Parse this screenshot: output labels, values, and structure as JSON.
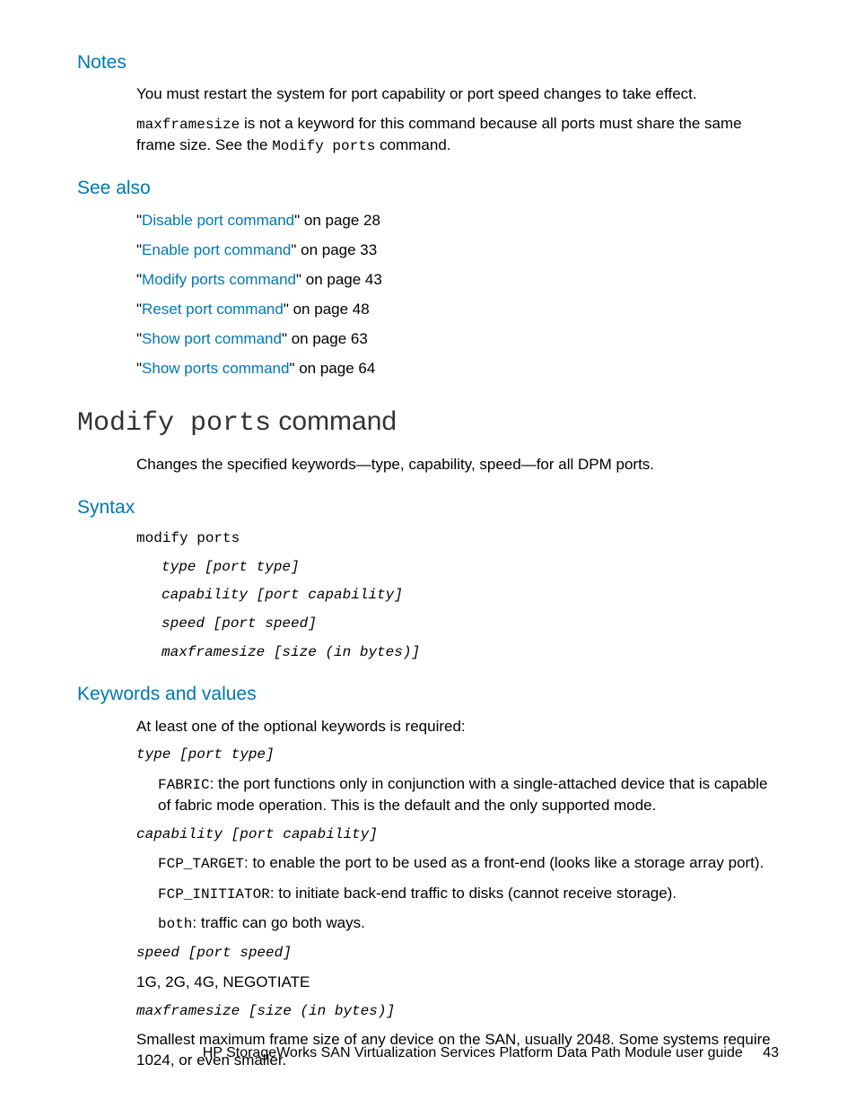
{
  "notes": {
    "heading": "Notes",
    "p1": "You must restart the system for port capability or port speed changes to take effect.",
    "p2a": "maxframesize",
    "p2b": " is not a keyword for this command because all ports must share the same frame size. See the ",
    "p2c": "Modify ports",
    "p2d": " command."
  },
  "seealso": {
    "heading": "See also",
    "items": [
      {
        "link": "Disable port command",
        "suffix": "\" on page 28"
      },
      {
        "link": "Enable port command",
        "suffix": "\" on page 33"
      },
      {
        "link": "Modify ports command",
        "suffix": "\" on page 43"
      },
      {
        "link": "Reset port command",
        "suffix": "\" on page 48"
      },
      {
        "link": "Show port command",
        "suffix": "\" on page 63"
      },
      {
        "link": "Show ports command",
        "suffix": "\" on page 64"
      }
    ]
  },
  "cmd": {
    "title_mono": "Modify ports",
    "title_rest": " command",
    "desc": "Changes the specified keywords—type, capability, speed—for all DPM ports."
  },
  "syntax": {
    "heading": "Syntax",
    "line0": "modify ports",
    "line1": "type [port type]",
    "line2": "capability [port capability]",
    "line3": "speed [port speed]",
    "line4": "maxframesize [size (in bytes)]"
  },
  "kv": {
    "heading": "Keywords and values",
    "intro": "At least one of the optional keywords is required:",
    "k1": "type [port type]",
    "k1_v_mono": "FABRIC",
    "k1_v_rest": ": the port functions only in conjunction with a single-attached device that is capable of fabric mode operation. This is the default and the only supported mode.",
    "k2": "capability [port capability]",
    "k2_a_mono": "FCP_TARGET",
    "k2_a_rest": ": to enable the port to be used as a front-end (looks like a storage array port).",
    "k2_b_mono": "FCP_INITIATOR",
    "k2_b_rest": ": to initiate back-end traffic to disks (cannot receive storage).",
    "k2_c_mono": "both",
    "k2_c_rest": ": traffic can go both ways.",
    "k3": "speed [port speed]",
    "k3_v": "1G, 2G, 4G, NEGOTIATE",
    "k4": "maxframesize [size (in bytes)]",
    "k4_v": "Smallest maximum frame size of any device on the SAN, usually 2048. Some systems require 1024, or even smaller."
  },
  "footer": {
    "title": "HP StorageWorks SAN Virtualization Services Platform Data Path Module user guide",
    "page": "43"
  }
}
